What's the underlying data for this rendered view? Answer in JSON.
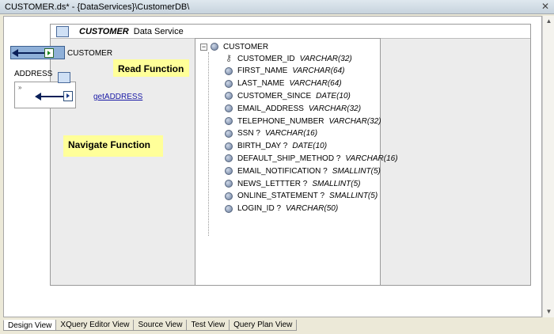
{
  "window": {
    "title": "CUSTOMER.ds* - {DataServices}\\CustomerDB\\",
    "close_glyph": "✕"
  },
  "data_service": {
    "name": "CUSTOMER",
    "subtitle": "Data Service",
    "icon": "data-service-icon"
  },
  "left_panel": {
    "read_function_label": "CUSTOMER",
    "address_label": "ADDRESS",
    "nav_function_link": "getADDRESS"
  },
  "callouts": {
    "read": "Read Function",
    "navigate": "Navigate Function"
  },
  "tree": {
    "root": {
      "name": "CUSTOMER",
      "expander": "⊟"
    },
    "fields": [
      {
        "name": "CUSTOMER_ID",
        "type": "VARCHAR(32)",
        "icon": "key-icon"
      },
      {
        "name": "FIRST_NAME",
        "type": "VARCHAR(64)",
        "icon": "element-icon"
      },
      {
        "name": "LAST_NAME",
        "type": "VARCHAR(64)",
        "icon": "element-icon"
      },
      {
        "name": "CUSTOMER_SINCE",
        "type": "DATE(10)",
        "icon": "element-icon"
      },
      {
        "name": "EMAIL_ADDRESS",
        "type": "VARCHAR(32)",
        "icon": "element-icon"
      },
      {
        "name": "TELEPHONE_NUMBER",
        "type": "VARCHAR(32)",
        "icon": "element-icon"
      },
      {
        "name": "SSN ?",
        "type": "VARCHAR(16)",
        "icon": "element-icon"
      },
      {
        "name": "BIRTH_DAY ?",
        "type": "DATE(10)",
        "icon": "element-icon"
      },
      {
        "name": "DEFAULT_SHIP_METHOD ?",
        "type": "VARCHAR(16)",
        "icon": "element-icon"
      },
      {
        "name": "EMAIL_NOTIFICATION ?",
        "type": "SMALLINT(5)",
        "icon": "element-icon"
      },
      {
        "name": "NEWS_LETTTER ?",
        "type": "SMALLINT(5)",
        "icon": "element-icon"
      },
      {
        "name": "ONLINE_STATEMENT ?",
        "type": "SMALLINT(5)",
        "icon": "element-icon"
      },
      {
        "name": "LOGIN_ID ?",
        "type": "VARCHAR(50)",
        "icon": "element-icon"
      }
    ]
  },
  "bottom_tabs": [
    {
      "label": "Design View",
      "active": true
    },
    {
      "label": "XQuery Editor View",
      "active": false
    },
    {
      "label": "Source View",
      "active": false
    },
    {
      "label": "Test View",
      "active": false
    },
    {
      "label": "Query Plan View",
      "active": false
    }
  ],
  "colors": {
    "callout_bg": "#ffff99",
    "read_function_bg": "#8fb0d8",
    "link": "#1a1aa6"
  }
}
